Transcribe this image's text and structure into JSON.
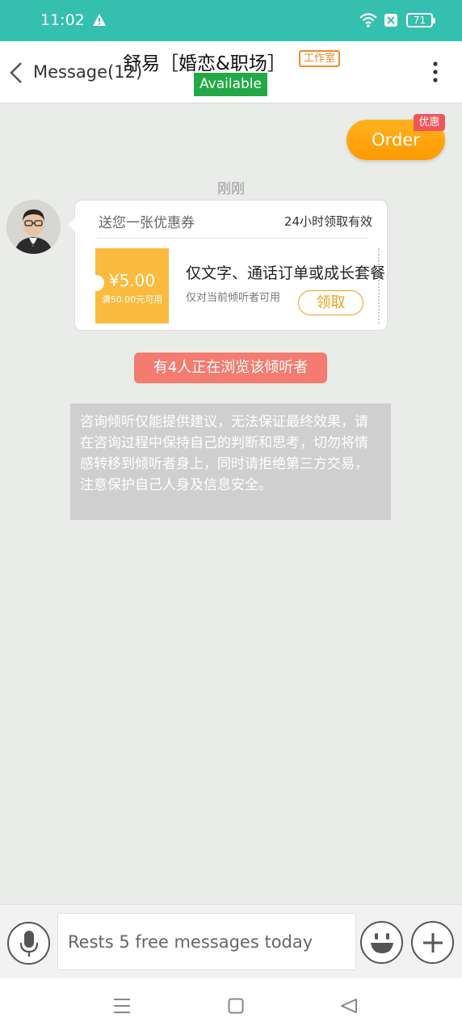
{
  "status_bar": {
    "time": "11:02",
    "battery": "71",
    "icons": [
      "warning-icon",
      "wifi-icon",
      "sim-disabled-icon",
      "battery-icon"
    ]
  },
  "header": {
    "back_label": "Message(12)",
    "title": "舒易［婚恋&职场］",
    "studio_badge": "工作室",
    "status": "Available",
    "status_color": "#22a945"
  },
  "order_button": {
    "label": "Order",
    "promo_tag": "优惠"
  },
  "chat": {
    "timestamp": "刚刚",
    "coupon": {
      "header_left": "送您一张优惠券",
      "header_right": "24小时领取有效",
      "amount": "¥5.00",
      "min_spend": "满50.00元可用",
      "title": "仅文字、通话订单或成长套餐",
      "subtitle": "仅对当前倾听者可用",
      "claim_label": "领取"
    },
    "browsing_notice": "有4人正在浏览该倾听者",
    "disclaimer": "咨询倾听仅能提供建议，无法保证最终效果，请在咨询过程中保持自己的判断和思考，切勿将情感转移到倾听者身上，同时请拒绝第三方交易，注意保护自己人身及信息安全。"
  },
  "input_bar": {
    "placeholder": "Rests 5 free messages today"
  },
  "colors": {
    "status_bar": "#35bfae",
    "order": "#ffa412",
    "coupon": "#fbbb3e",
    "browsing": "#f47b6f"
  }
}
